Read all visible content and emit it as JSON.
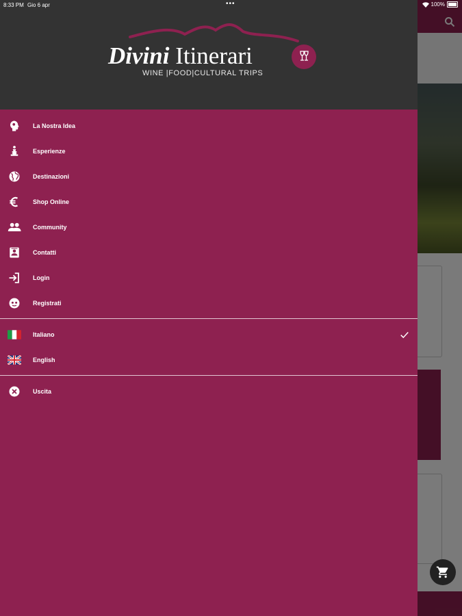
{
  "status_bar": {
    "time": "8:33 PM",
    "date": "Gio 6 apr",
    "dots": "•••",
    "battery": "100%"
  },
  "brand": {
    "name_part1": "Divini",
    "name_part2": "Itinerari",
    "tagline": "WINE  |FOOD|CULTURAL TRIPS"
  },
  "menu": {
    "items": [
      {
        "label": "La Nostra Idea",
        "icon": "lightbulb-head-icon"
      },
      {
        "label": "Esperienze",
        "icon": "figure-icon"
      },
      {
        "label": "Destinazioni",
        "icon": "globe-icon"
      },
      {
        "label": "Shop Online",
        "icon": "euro-icon"
      },
      {
        "label": "Community",
        "icon": "people-icon"
      },
      {
        "label": "Contatti",
        "icon": "contact-card-icon"
      },
      {
        "label": "Login",
        "icon": "login-icon"
      },
      {
        "label": "Registrati",
        "icon": "register-face-icon"
      }
    ],
    "languages": [
      {
        "label": "Italiano",
        "icon": "italy-flag-icon",
        "selected": true
      },
      {
        "label": "English",
        "icon": "uk-flag-icon",
        "selected": false
      }
    ],
    "exit": {
      "label": "Uscita",
      "icon": "close-circle-icon"
    }
  },
  "colors": {
    "accent": "#8e2150",
    "header": "#333333",
    "text": "#ffffff"
  }
}
